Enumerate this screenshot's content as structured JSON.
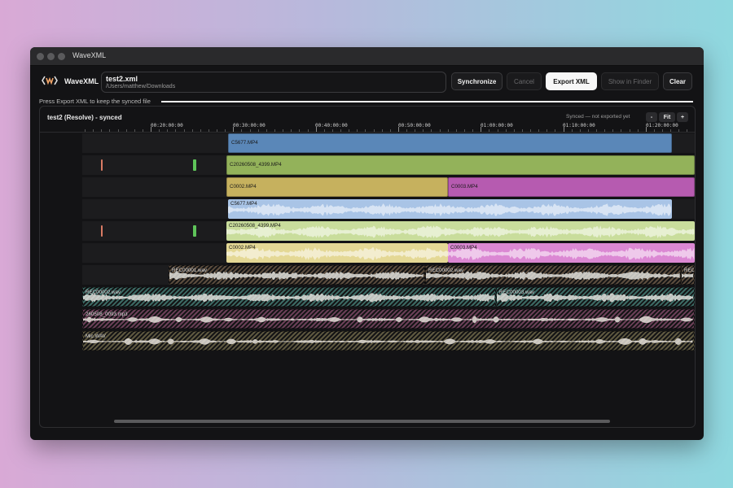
{
  "window": {
    "app_title": "WaveXML"
  },
  "toolbar": {
    "brand": "WaveXML",
    "file_name": "test2.xml",
    "file_path": "/Users/matthew/Downloads",
    "buttons": {
      "synchronize": "Synchronize",
      "cancel": "Cancel",
      "export_xml": "Export XML",
      "show_in_finder": "Show in Finder",
      "clear": "Clear"
    }
  },
  "status": {
    "message": "Press Export XML to keep the synced file",
    "progress": 1.0
  },
  "timeline": {
    "title": "test2 (Resolve) - synced",
    "sync_note": "Synced — not exported yet",
    "zoom_out": "-",
    "zoom_fit": "Fit",
    "zoom_in": "+",
    "ruler_labels": [
      "00:20:00:00",
      "00:30:00:00",
      "00:40:00:00",
      "00:50:00:00",
      "01:00:00:00",
      "01:10:00:00",
      "01:20:00:00"
    ],
    "tracks": [
      {
        "kind": "video",
        "clips": [
          {
            "label": "C5677.MP4",
            "color": "#5a87b8"
          }
        ]
      },
      {
        "kind": "video",
        "clips": [
          {
            "label": "C20260508_4399.MP4",
            "color": "#93b25a"
          }
        ]
      },
      {
        "kind": "video",
        "clips": [
          {
            "label": "C0002.MP4",
            "color": "#c6b15e"
          },
          {
            "label": "C0003.MP4",
            "color": "#b65bb0"
          }
        ]
      },
      {
        "kind": "audio",
        "clips": [
          {
            "label": "C5677.MP4",
            "color": "#a9c4e6"
          }
        ]
      },
      {
        "kind": "audio",
        "clips": [
          {
            "label": "C20260508_4399.MP4",
            "color": "#c9dd9c"
          }
        ]
      },
      {
        "kind": "audio",
        "clips": [
          {
            "label": "C0002.MP4",
            "color": "#e4d895"
          },
          {
            "label": "C0003.MP4",
            "color": "#db88d3"
          }
        ]
      },
      {
        "kind": "audio",
        "clips": [
          {
            "label": "REC00001.wav",
            "color": "#5c4d3e"
          },
          {
            "label": "REC00002.wav",
            "color": "#5c4d3e"
          },
          {
            "label": "REC",
            "color": "#5c4d3e"
          }
        ]
      },
      {
        "kind": "audio",
        "clips": [
          {
            "label": "REC00002.wav",
            "color": "#3c6a64"
          },
          {
            "label": "REC00003.wav",
            "color": "#3c6a64"
          }
        ]
      },
      {
        "kind": "audio",
        "clips": [
          {
            "label": "260508_0093.mp3",
            "color": "#6a3f57"
          }
        ]
      },
      {
        "kind": "audio",
        "clips": [
          {
            "label": "Mic.WAV",
            "color": "#5e5840"
          }
        ]
      }
    ]
  },
  "colors": {
    "marker_red": "#d97b64",
    "marker_green": "#5fc45a"
  },
  "icons": {
    "logo": "wavexml-logo-icon"
  }
}
